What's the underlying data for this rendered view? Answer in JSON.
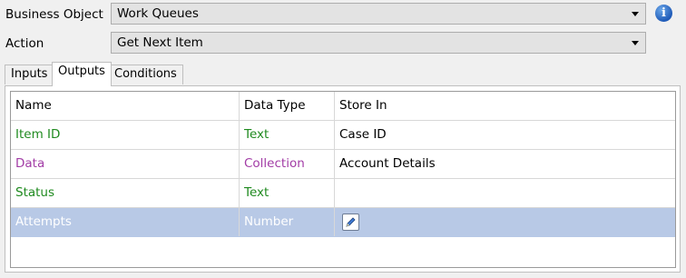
{
  "business_object": {
    "label": "Business Object",
    "value": "Work Queues"
  },
  "action": {
    "label": "Action",
    "value": "Get Next Item"
  },
  "tabs": [
    {
      "label": "Inputs"
    },
    {
      "label": "Outputs"
    },
    {
      "label": "Conditions"
    }
  ],
  "table": {
    "headers": [
      "Name",
      "Data Type",
      "Store In"
    ],
    "rows": [
      {
        "name": "Item ID",
        "type": "Text",
        "store": "Case ID",
        "color": "#1f8a1f"
      },
      {
        "name": "Data",
        "type": "Collection",
        "store": "Account Details",
        "color": "#a23ca6"
      },
      {
        "name": "Status",
        "type": "Text",
        "store": "",
        "color": "#1f8a1f"
      },
      {
        "name": "Attempts",
        "type": "Number",
        "store": "",
        "selected": true,
        "icon": "edit-icon"
      }
    ]
  },
  "icons": {
    "info": "info-icon",
    "dropdown": "chevron-down-icon"
  }
}
